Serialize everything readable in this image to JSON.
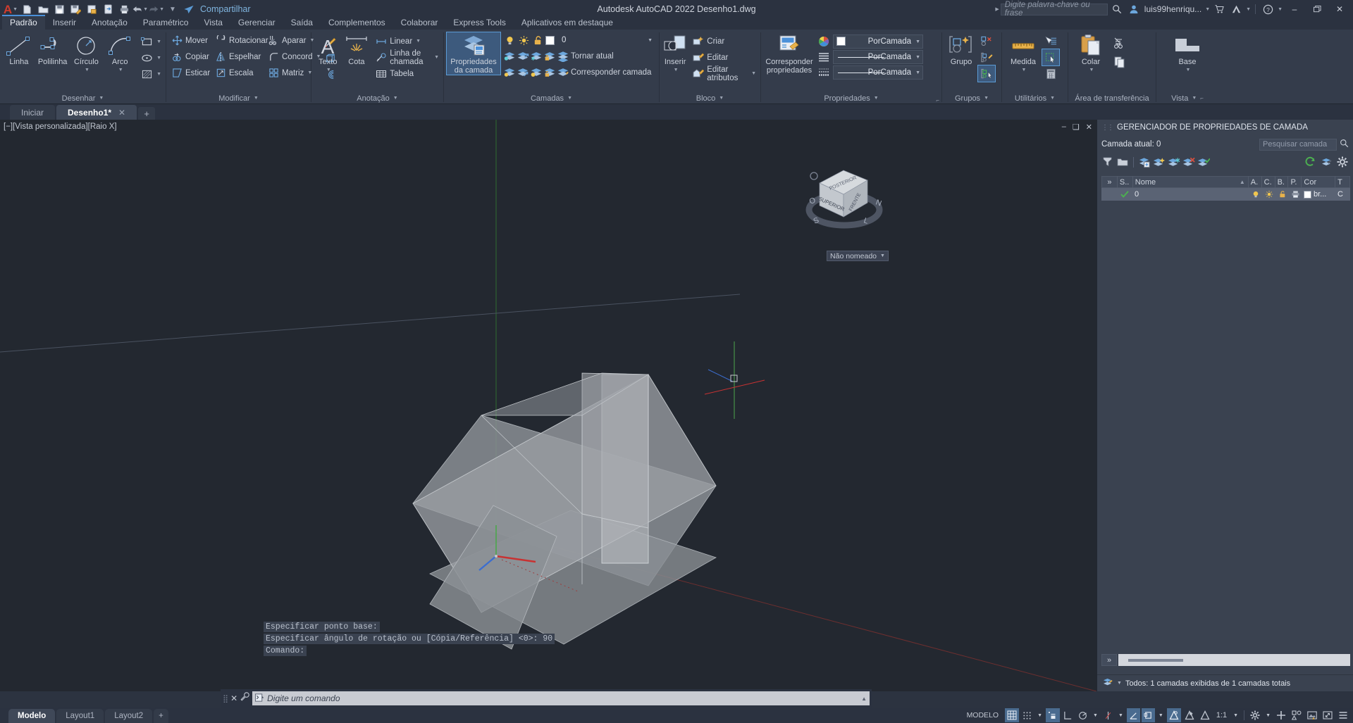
{
  "titlebar": {
    "app_menu": "A",
    "quick_access": [
      "new-icon",
      "open-icon",
      "save-icon",
      "saveas-icon",
      "plot-preview-icon",
      "export-icon",
      "print-icon",
      "undo-icon",
      "redo-icon",
      "customize-icon"
    ],
    "share_label": "Compartilhar",
    "title": "Autodesk AutoCAD 2022   Desenho1.dwg",
    "search_placeholder": "Digite palavra-chave ou frase",
    "user": "luis99henriqu...",
    "minimize": "–",
    "restore": "❐",
    "close": "✕"
  },
  "menu_tabs": [
    {
      "label": "Padrão",
      "active": true
    },
    {
      "label": "Inserir",
      "active": false
    },
    {
      "label": "Anotação",
      "active": false
    },
    {
      "label": "Paramétrico",
      "active": false
    },
    {
      "label": "Vista",
      "active": false
    },
    {
      "label": "Gerenciar",
      "active": false
    },
    {
      "label": "Saída",
      "active": false
    },
    {
      "label": "Complementos",
      "active": false
    },
    {
      "label": "Colaborar",
      "active": false
    },
    {
      "label": "Express Tools",
      "active": false
    },
    {
      "label": "Aplicativos em destaque",
      "active": false
    }
  ],
  "ribbon": {
    "panels": [
      {
        "name": "desenhar",
        "title": "Desenhar",
        "big_buttons": [
          {
            "label": "Linha",
            "icon": "line-icon",
            "dropdown": false
          },
          {
            "label": "Polilinha",
            "icon": "polyline-icon",
            "dropdown": false
          },
          {
            "label": "Círculo",
            "icon": "circle-icon",
            "dropdown": true
          },
          {
            "label": "Arco",
            "icon": "arc-icon",
            "dropdown": true
          }
        ],
        "small_buttons": [
          {
            "label": "",
            "icon": "rectangle-icon",
            "dropdown": true
          },
          {
            "label": "",
            "icon": "ellipse-icon",
            "dropdown": true
          },
          {
            "label": "",
            "icon": "hatch-icon",
            "dropdown": true
          }
        ]
      },
      {
        "name": "modificar",
        "title": "Modificar",
        "rows": [
          [
            {
              "label": "Mover",
              "icon": "move-icon"
            },
            {
              "label": "Rotacionar",
              "icon": "rotate-icon"
            },
            {
              "label": "Aparar",
              "icon": "trim-icon",
              "dropdown": true
            }
          ],
          [
            {
              "label": "Copiar",
              "icon": "copy-icon"
            },
            {
              "label": "Espelhar",
              "icon": "mirror-icon"
            },
            {
              "label": "Concord",
              "icon": "fillet-icon",
              "dropdown": true
            }
          ],
          [
            {
              "label": "Esticar",
              "icon": "stretch-icon"
            },
            {
              "label": "Escala",
              "icon": "scale-icon"
            },
            {
              "label": "Matriz",
              "icon": "array-icon",
              "dropdown": true
            }
          ]
        ],
        "extra_icons": [
          "brush-icon",
          "3dsolid-icon",
          "offset-icon"
        ]
      },
      {
        "name": "anotacao",
        "title": "Anotação",
        "big_buttons": [
          {
            "label": "Texto",
            "icon": "text-icon",
            "dropdown": true
          },
          {
            "label": "Cota",
            "icon": "dimension-icon",
            "dropdown": false
          }
        ],
        "rows": [
          {
            "label": "Linear",
            "icon": "linear-dim-icon",
            "dropdown": true
          },
          {
            "label": "Linha de chamada",
            "icon": "leader-icon",
            "dropdown": true
          },
          {
            "label": "Tabela",
            "icon": "table-icon",
            "dropdown": false
          }
        ]
      },
      {
        "name": "camadas",
        "title": "Camadas",
        "big_button": {
          "label_line1": "Propriedades",
          "label_line2": "da camada",
          "icon": "layer-properties-icon",
          "selected": true
        },
        "layer_combo": {
          "value": "0",
          "swatch": "#ffffff",
          "icons": [
            "lightbulb-icon",
            "sun-icon",
            "unlock-icon"
          ]
        },
        "row_buttons": [
          {
            "label": "Tornar atual",
            "icon": "make-current-icon"
          },
          {
            "label": "Corresponder camada",
            "icon": "match-layer-icon"
          }
        ],
        "icon_grid_row1": [
          "layer-isolate-icon",
          "layer-unisolate-icon",
          "layer-freeze-icon",
          "layer-lock-icon"
        ],
        "icon_grid_row2": [
          "layer-off-icon",
          "layer-turn-all-on-icon",
          "layer-thaw-icon",
          "layer-unlock-icon"
        ]
      },
      {
        "name": "bloco",
        "title": "Bloco",
        "big_button": {
          "label": "Inserir",
          "icon": "insert-block-icon",
          "dropdown": true
        },
        "rows": [
          {
            "label": "Criar",
            "icon": "create-block-icon"
          },
          {
            "label": "Editar",
            "icon": "edit-block-icon"
          },
          {
            "label": "Editar atributos",
            "icon": "edit-attributes-icon",
            "dropdown": true
          }
        ]
      },
      {
        "name": "propriedades",
        "title": "Propriedades",
        "big_button": {
          "label_line1": "Corresponder",
          "label_line2": "propriedades",
          "icon": "match-properties-icon"
        },
        "combos": [
          {
            "value": "PorCamada",
            "icon": "color-wheel-icon",
            "swatch": "#ffffff",
            "kind": "color"
          },
          {
            "value": "PorCamada",
            "icon": "linetype-icon",
            "kind": "linetype"
          },
          {
            "value": "PorCamada",
            "icon": "lineweight-icon",
            "kind": "lineweight"
          }
        ],
        "has_expander": true
      },
      {
        "name": "grupos",
        "title": "Grupos",
        "big_button": {
          "label": "Grupo",
          "icon": "group-icon"
        },
        "small_icons": [
          "ungroup-icon",
          "group-edit-icon",
          "group-selection-icon"
        ]
      },
      {
        "name": "utilitarios",
        "title": "Utilitários",
        "big_button": {
          "label": "Medida",
          "icon": "measure-icon",
          "dropdown": true
        },
        "small_icons": [
          "quick-select-icon",
          "quick-measure-icon",
          "calculator-icon"
        ]
      },
      {
        "name": "area-transferencia",
        "title": "Área de transferência",
        "big_button": {
          "label": "Colar",
          "icon": "paste-icon",
          "dropdown": true
        },
        "small_icons": [
          "cut-icon",
          "copy-clip-icon"
        ]
      },
      {
        "name": "vista",
        "title": "Vista",
        "big_button": {
          "label": "Base",
          "icon": "base-view-icon",
          "dropdown": true
        },
        "has_expander": true
      }
    ]
  },
  "file_tabs": [
    {
      "label": "Iniciar",
      "active": false,
      "closeable": false
    },
    {
      "label": "Desenho1*",
      "active": true,
      "closeable": true,
      "close_glyph": "✕"
    }
  ],
  "file_tab_add": "+",
  "viewport": {
    "label": "[−][Vista personalizada][Raio X]",
    "controls": [
      "minimize-viewport-icon",
      "maximize-viewport-icon",
      "close-viewport-icon"
    ],
    "viewcube": {
      "faces": {
        "top": "SUPERIOR",
        "front_right": "FRENTE",
        "left_rot": "POSTERIOR"
      },
      "compass": [
        "O",
        "N",
        "L",
        "S"
      ]
    },
    "view_label": "Não nomeado"
  },
  "command_history": [
    "Especificar ponto base:",
    "Especificar ângulo de rotação ou [Cópia/Referência] <0>: 90",
    "Comando:"
  ],
  "command_input": {
    "placeholder": "Digite um comando",
    "prompt_icon": "command-prompt-icon",
    "close_icon": "✕",
    "settings_icon": "wrench-icon"
  },
  "layer_palette": {
    "title": "GERENCIADOR DE PROPRIEDADES DE CAMADA",
    "current_layer_label": "Camada atual: 0",
    "search_placeholder": "Pesquisar camada",
    "search_icon": "search-icon",
    "toolbar_left": [
      "new-property-filter-icon",
      "new-group-filter-icon",
      "layer-states-icon",
      "new-layer-icon",
      "new-layer-vp-frozen-icon",
      "delete-layer-icon",
      "set-current-icon"
    ],
    "toolbar_right": [
      "refresh-icon",
      "viewport-overrides-icon",
      "settings-gear-icon"
    ],
    "columns": [
      "»",
      "S..",
      "Nome",
      "A.",
      "C.",
      "B.",
      "P.",
      "Cor",
      "T"
    ],
    "rows": [
      {
        "status": "current",
        "name": "0",
        "on": "lightbulb-icon",
        "freeze": "sun-icon",
        "lock": "unlock-icon",
        "plot": "print-icon",
        "color_swatch": "#ffffff",
        "color": "br...",
        "linetype": "C"
      }
    ],
    "expander": "»",
    "status_text": "Todos: 1 camadas exibidas de 1 camadas totais",
    "status_icon": "layer-filter-icon"
  },
  "status_bar": {
    "layout_tabs": [
      {
        "label": "Modelo",
        "active": true
      },
      {
        "label": "Layout1",
        "active": false
      },
      {
        "label": "Layout2",
        "active": false
      }
    ],
    "add_layout": "+",
    "model_label": "MODELO",
    "scale": "1:1",
    "toggles": [
      {
        "name": "grid-display-toggle",
        "icon": "grid-icon",
        "on": true
      },
      {
        "name": "snap-mode-toggle",
        "icon": "snap-icon",
        "on": false,
        "dropdown": true
      },
      {
        "name": "ortho-mode-toggle",
        "icon": "infer-constraints-icon",
        "on": true
      },
      {
        "name": "dynamic-ucs-toggle",
        "icon": "ucs-icon",
        "on": false
      },
      {
        "name": "polar-tracking-toggle",
        "icon": "polar-icon",
        "on": false,
        "dropdown": true
      },
      {
        "name": "osnap-toggle",
        "icon": "osnap-icon",
        "on": false,
        "dropdown": true
      },
      {
        "name": "lineweight-toggle",
        "icon": "lineweight-display-icon",
        "on": true
      },
      {
        "name": "transparency-toggle",
        "icon": "transparency-icon",
        "on": false,
        "dropdown": true
      },
      {
        "name": "selection-cycling-toggle",
        "icon": "selection-cycling-icon",
        "on": true
      },
      {
        "name": "annotation-visibility-toggle",
        "icon": "annotation-visibility-icon",
        "on": false
      },
      {
        "name": "autoscale-toggle",
        "icon": "autoscale-icon",
        "on": false
      },
      {
        "name": "workspace-switch",
        "icon": "gear-icon",
        "on": false,
        "dropdown": true
      },
      {
        "name": "isolate-objects",
        "icon": "isolate-icon",
        "on": false
      },
      {
        "name": "hardware-accel",
        "icon": "hardware-accel-icon",
        "on": false
      },
      {
        "name": "clean-screen",
        "icon": "fullscreen-icon",
        "on": false
      },
      {
        "name": "customization",
        "icon": "hamburger-icon",
        "on": false
      }
    ]
  },
  "colors": {
    "accent": "#4a90d9",
    "ribbon_bg": "#343c4b",
    "titlebar_bg": "#2b3240",
    "canvas_bg": "#232830",
    "palette_bg": "#3a4250",
    "selection": "#5a6374",
    "autodesk_red": "#cf3c2e",
    "axis_x": "#c83232",
    "axis_y": "#4ca64c",
    "axis_z": "#3c6ecf"
  }
}
